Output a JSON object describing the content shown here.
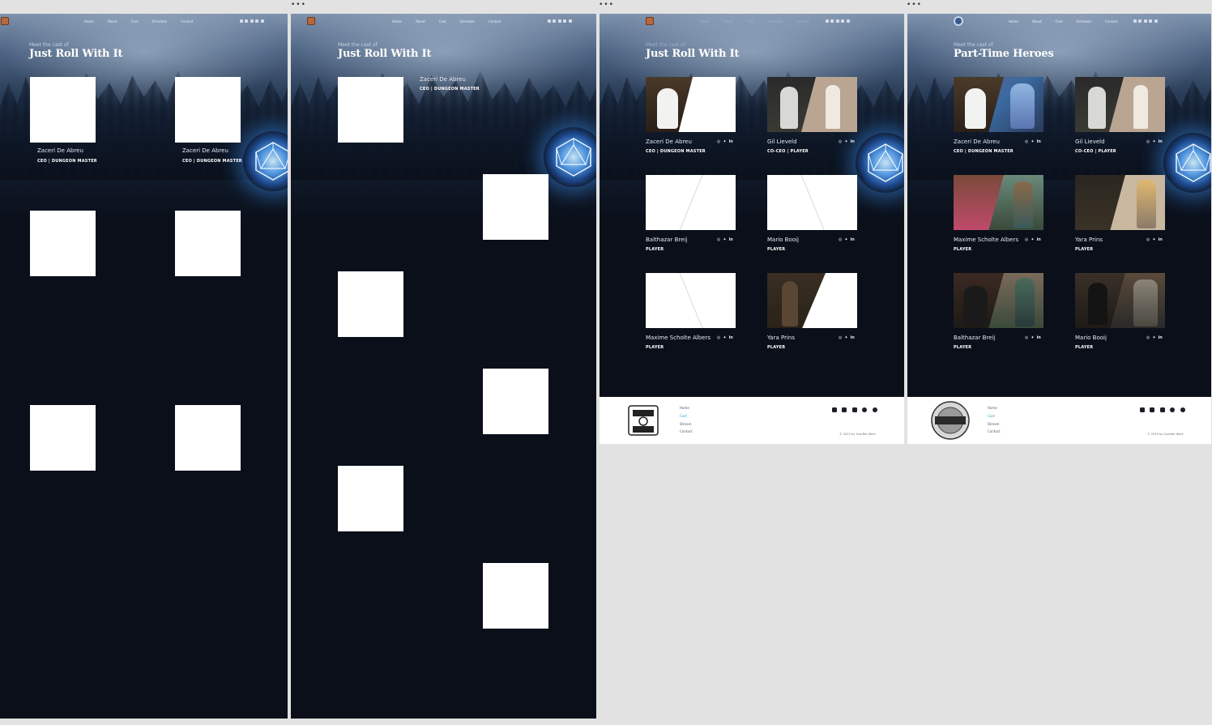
{
  "frame_menu": "•••",
  "nav": {
    "links": [
      "Home",
      "About",
      "Cast",
      "Schedule",
      "Contact"
    ]
  },
  "site_a": {
    "eyebrow": "Meet the cast of",
    "title": "Just Roll With It"
  },
  "site_b": {
    "eyebrow": "Meet the cast of",
    "title": "Part-Time Heroes"
  },
  "cast_frame1": [
    {
      "name": "Zaceri De Abreu",
      "role": "CEO  |  DUNGEON MASTER"
    },
    {
      "name": "Zaceri De Abreu",
      "role": "CEO  |  DUNGEON MASTER"
    }
  ],
  "cast_frame2": {
    "name": "Zaceri De Abreu",
    "role": "CEO  |  DUNGEON MASTER"
  },
  "cast_frame3": [
    {
      "name": "Zaceri De Abreu",
      "role": "CEO  |  DUNGEON MASTER"
    },
    {
      "name": "Gil Lieveld",
      "role": "CO-CEO  |  PLAYER"
    },
    {
      "name": "Balthazar Breij",
      "role": "PLAYER"
    },
    {
      "name": "Mario Booij",
      "role": "PLAYER"
    },
    {
      "name": "Maxime Scholte Albers",
      "role": "PLAYER"
    },
    {
      "name": "Yara Prins",
      "role": "PLAYER"
    }
  ],
  "cast_frame4": [
    {
      "name": "Zaceri De Abreu",
      "role": "CEO  |  DUNGEON MASTER"
    },
    {
      "name": "Gil Lieveld",
      "role": "CO-CEO  |  PLAYER"
    },
    {
      "name": "Maxime Scholte Albers",
      "role": "PLAYER"
    },
    {
      "name": "Yara Prins",
      "role": "PLAYER"
    },
    {
      "name": "Balthazar Breij",
      "role": "PLAYER"
    },
    {
      "name": "Mario Booij",
      "role": "PLAYER"
    }
  ],
  "social_glyphs": {
    "instagram": "◎",
    "twitter": "✦",
    "linkedin": "in"
  },
  "footer": {
    "links": [
      "Home",
      "Cast",
      "Stream",
      "Contact"
    ],
    "copyright": "© 2025 by SuerBal Werk"
  },
  "colors": {
    "page_bg": "#0a0f19",
    "canvas_bg": "#e2e2e2",
    "accent": "#3aa0c9",
    "d20_glow": "#3c96ff"
  }
}
